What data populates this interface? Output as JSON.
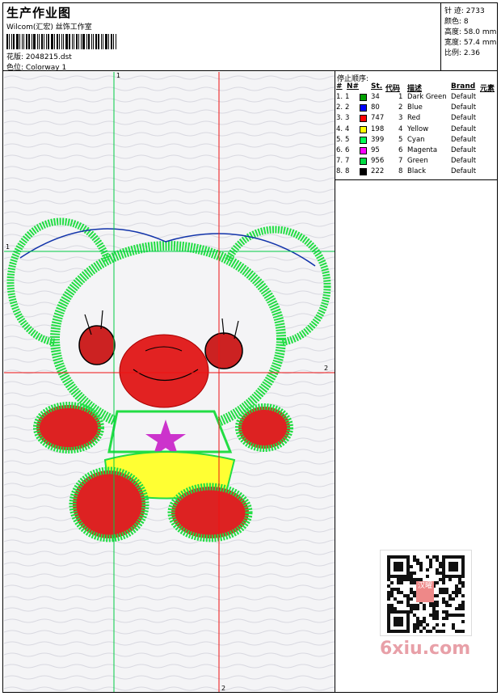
{
  "header": {
    "title": "生产作业图",
    "company": "Wilcom(汇宏) 丝饰工作室",
    "pattern_label": "花版:",
    "pattern_value": "2048215.dst",
    "colorway_label": "色位:",
    "colorway_value": "Colorway 1"
  },
  "stats": {
    "stitches_label": "针 迹:",
    "stitches": "2733",
    "colors_label": "颜色:",
    "colors": "8",
    "height_label": "高度:",
    "height": "58.0 mm",
    "width_label": "宽度:",
    "width": "57.4 mm",
    "scale_label": "比例:",
    "scale": "2.36"
  },
  "stop_sequence": {
    "title": "停止顺序:",
    "headers": {
      "num": "#",
      "n": "N#",
      "st": "St.",
      "code": "代码",
      "desc": "描述",
      "brand": "Brand",
      "element": "元素"
    },
    "rows": [
      {
        "num": "1.",
        "n": "1",
        "color": "#00a000",
        "st": "34",
        "code": "1",
        "desc": "Dark Green",
        "brand": "Default"
      },
      {
        "num": "2.",
        "n": "2",
        "color": "#0000ff",
        "st": "80",
        "code": "2",
        "desc": "Blue",
        "brand": "Default"
      },
      {
        "num": "3.",
        "n": "3",
        "color": "#ff0000",
        "st": "747",
        "code": "3",
        "desc": "Red",
        "brand": "Default"
      },
      {
        "num": "4.",
        "n": "4",
        "color": "#ffff00",
        "st": "198",
        "code": "4",
        "desc": "Yellow",
        "brand": "Default"
      },
      {
        "num": "5.",
        "n": "5",
        "color": "#00ff55",
        "st": "399",
        "code": "5",
        "desc": "Cyan",
        "brand": "Default"
      },
      {
        "num": "6.",
        "n": "6",
        "color": "#ff00ff",
        "st": "95",
        "code": "6",
        "desc": "Magenta",
        "brand": "Default"
      },
      {
        "num": "7.",
        "n": "7",
        "color": "#00dd44",
        "st": "956",
        "code": "7",
        "desc": "Green",
        "brand": "Default"
      },
      {
        "num": "8.",
        "n": "8",
        "color": "#000000",
        "st": "222",
        "code": "8",
        "desc": "Black",
        "brand": "Default"
      }
    ]
  },
  "guides": {
    "v1": "1",
    "h1": "1",
    "h2": "2",
    "v2": "2"
  },
  "watermark": "6xiu.com",
  "qr_badge": "汉曜"
}
